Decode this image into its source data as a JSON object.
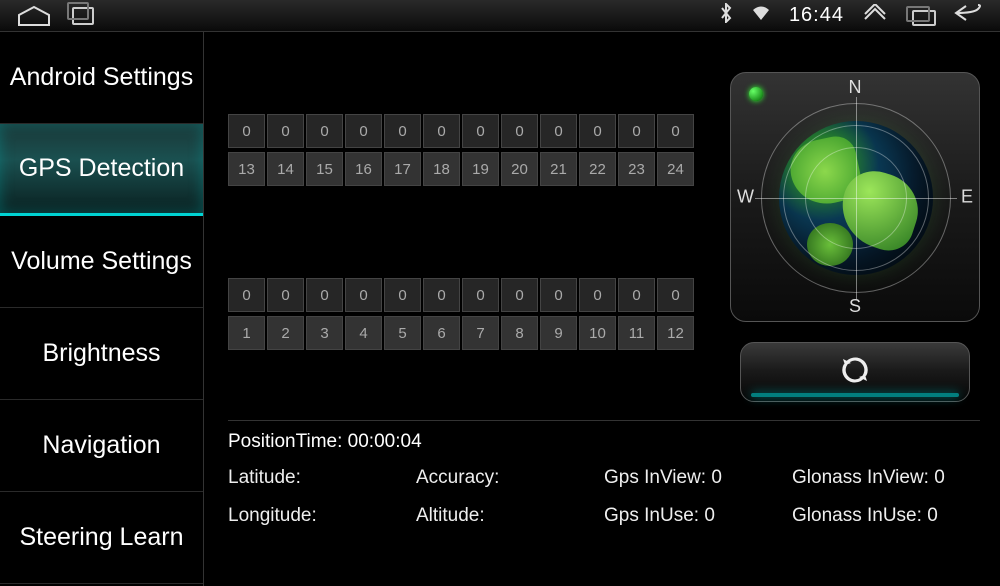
{
  "status": {
    "time": "16:44"
  },
  "compass": {
    "n": "N",
    "s": "S",
    "e": "E",
    "w": "W"
  },
  "sidebar": {
    "items": [
      {
        "label": "Android Settings"
      },
      {
        "label": "GPS Detection"
      },
      {
        "label": "Volume Settings"
      },
      {
        "label": "Brightness"
      },
      {
        "label": "Navigation"
      },
      {
        "label": "Steering Learn"
      }
    ],
    "active_index": 1
  },
  "sat_top": {
    "vals": [
      0,
      0,
      0,
      0,
      0,
      0,
      0,
      0,
      0,
      0,
      0,
      0
    ],
    "ids": [
      13,
      14,
      15,
      16,
      17,
      18,
      19,
      20,
      21,
      22,
      23,
      24
    ]
  },
  "sat_bot": {
    "vals": [
      0,
      0,
      0,
      0,
      0,
      0,
      0,
      0,
      0,
      0,
      0,
      0
    ],
    "ids": [
      1,
      2,
      3,
      4,
      5,
      6,
      7,
      8,
      9,
      10,
      11,
      12
    ]
  },
  "info": {
    "position_time_label": "PositionTime:",
    "position_time_value": "00:00:04",
    "latitude_label": "Latitude:",
    "latitude_value": "",
    "longitude_label": "Longitude:",
    "longitude_value": "",
    "accuracy_label": "Accuracy:",
    "accuracy_value": "",
    "altitude_label": "Altitude:",
    "altitude_value": "",
    "gps_inview_label": "Gps InView:",
    "gps_inview_value": "0",
    "gps_inuse_label": "Gps InUse:",
    "gps_inuse_value": "0",
    "glonass_inview_label": "Glonass InView:",
    "glonass_inview_value": "0",
    "glonass_inuse_label": "Glonass InUse:",
    "glonass_inuse_value": "0"
  }
}
